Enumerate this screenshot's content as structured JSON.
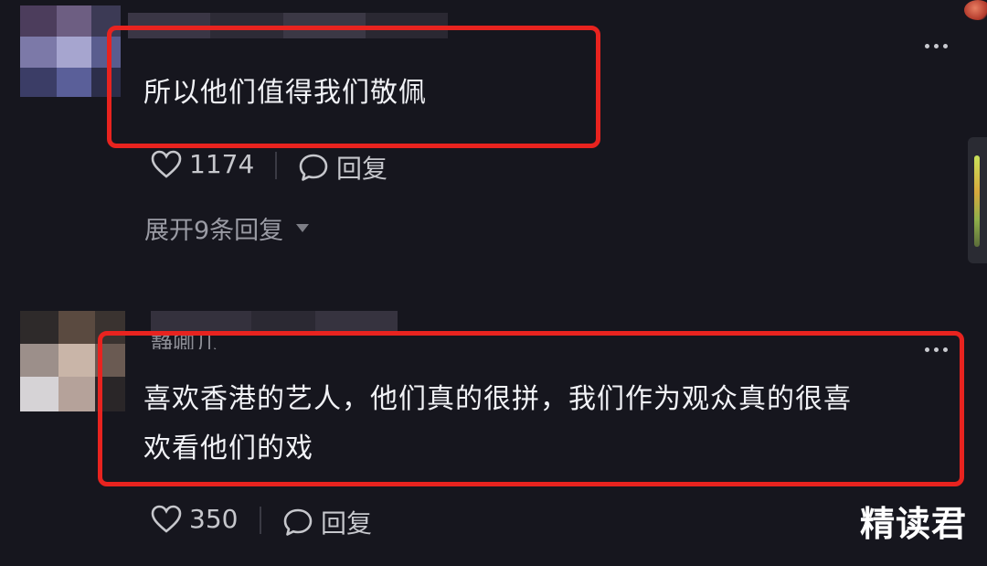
{
  "comments": [
    {
      "text": "所以他们值得我们敬佩",
      "likes": "1174",
      "reply_label": "回复",
      "expand_label": "展开9条回复"
    },
    {
      "username": "静卿儿",
      "text_line1": "喜欢香港的艺人，他们真的很拼，我们作为观众真的很喜",
      "text_line2": "欢看他们的戏",
      "likes": "350",
      "reply_label": "回复"
    }
  ],
  "watermark": "精读君",
  "icons": {
    "like": "heart-outline-icon",
    "reply": "speech-bubble-icon",
    "more": "more-dots-icon",
    "expand": "caret-down-icon"
  },
  "colors": {
    "background": "#16161e",
    "highlight_box": "#e8231f",
    "text": "#f1f2f6",
    "muted": "#9a9ba4"
  }
}
